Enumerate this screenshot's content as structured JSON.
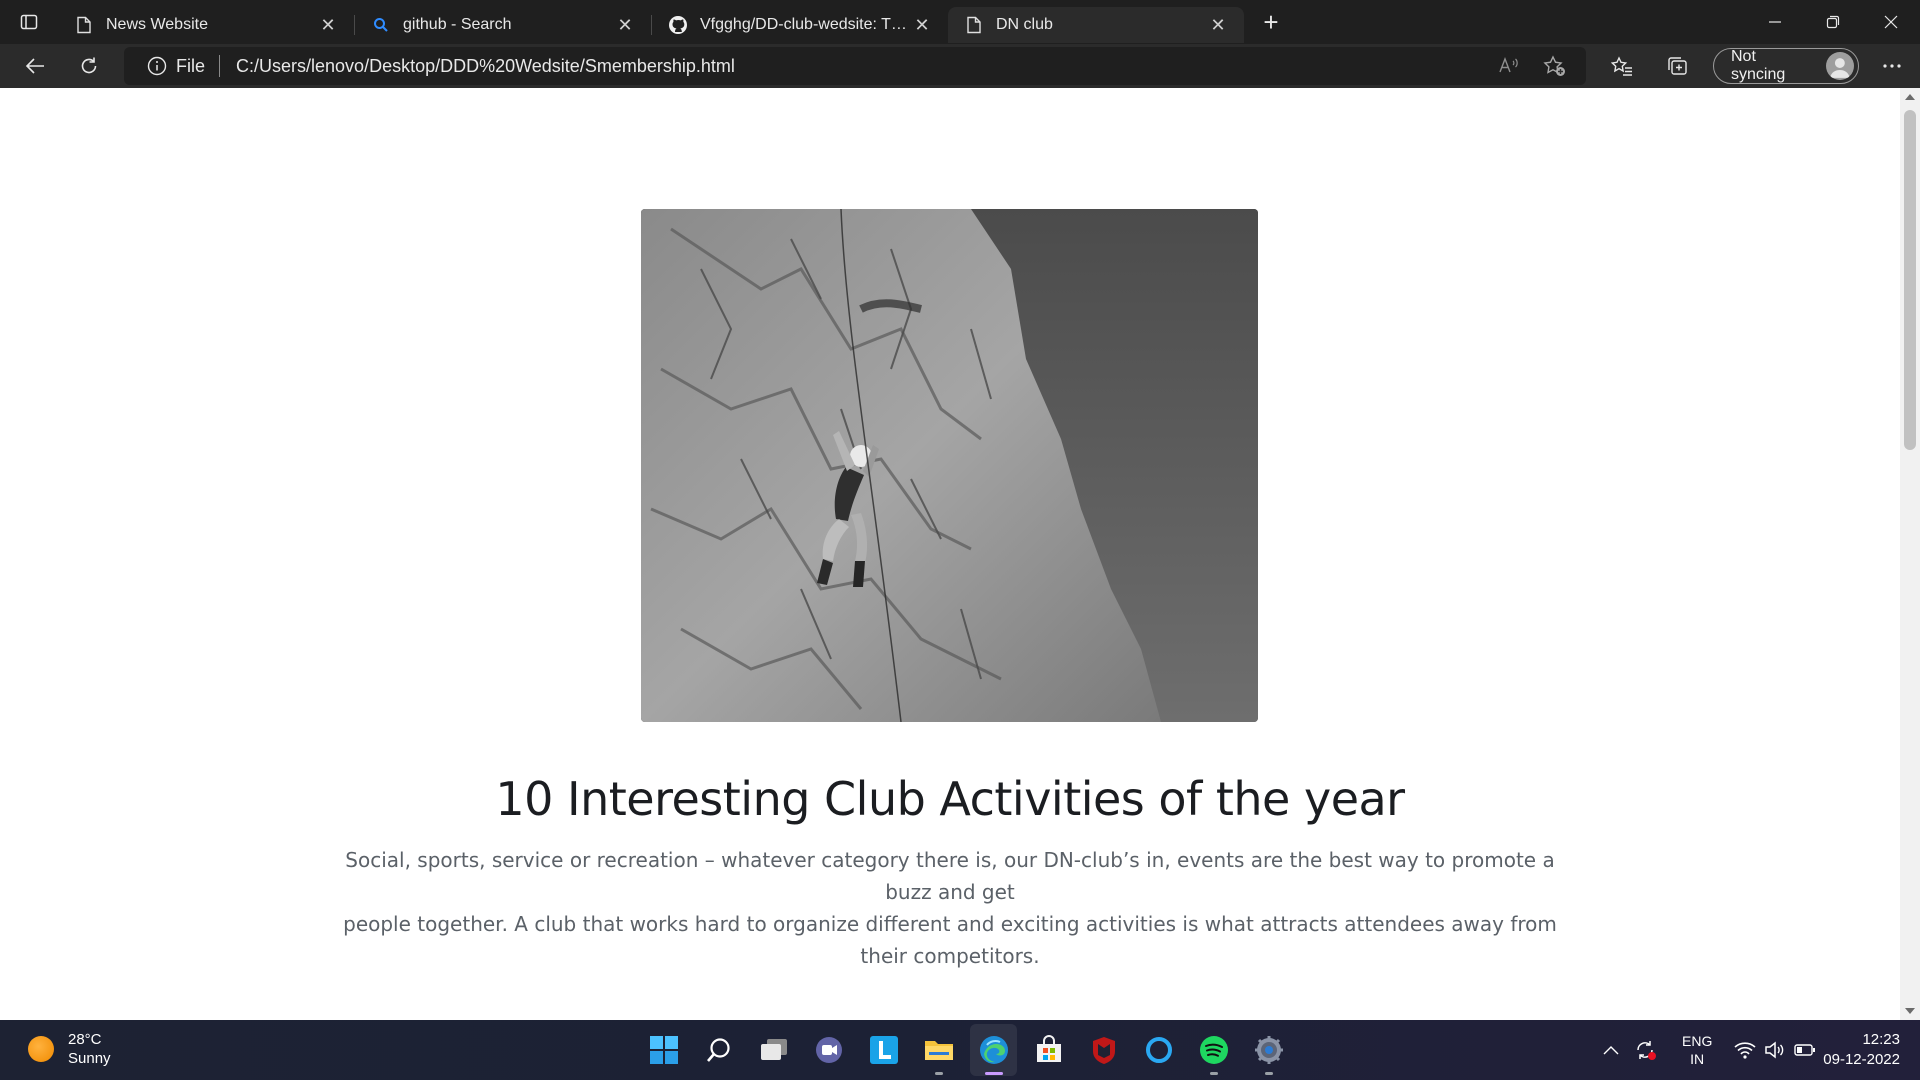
{
  "browser": {
    "tabs": [
      {
        "title": "News Website",
        "icon": "page-icon",
        "active": false
      },
      {
        "title": "github - Search",
        "icon": "search-icon",
        "active": false
      },
      {
        "title": "Vfgghg/DD-club-wedsite: This is",
        "icon": "github-icon",
        "active": false
      },
      {
        "title": "DN club",
        "icon": "page-icon",
        "active": true
      }
    ],
    "new_tab_label": "+",
    "address": {
      "scheme": "File",
      "url": "C:/Users/lenovo/Desktop/DDD%20Wedsite/Smembership.html"
    },
    "sync_label": "Not syncing"
  },
  "page": {
    "headline": "10 Interesting Club Activities of the year",
    "lead_line1": "Social, sports, service or recreation – whatever category there is, our DN-club’s in, events are the best way to promote a buzz and get",
    "lead_line2": "people together. A club that works hard to organize different and exciting activities is what attracts attendees away from their competitors."
  },
  "taskbar": {
    "weather": {
      "temp": "28°C",
      "condition": "Sunny"
    },
    "apps": [
      "windows-start-icon",
      "search-icon",
      "task-view-icon",
      "teams-chat-icon",
      "l-app-icon",
      "file-explorer-icon",
      "edge-icon",
      "store-icon",
      "mcafee-icon",
      "cortana-icon",
      "spotify-icon",
      "settings-icon"
    ],
    "language": {
      "line1": "ENG",
      "line2": "IN"
    },
    "clock": {
      "time": "12:23",
      "date": "09-12-2022"
    }
  }
}
